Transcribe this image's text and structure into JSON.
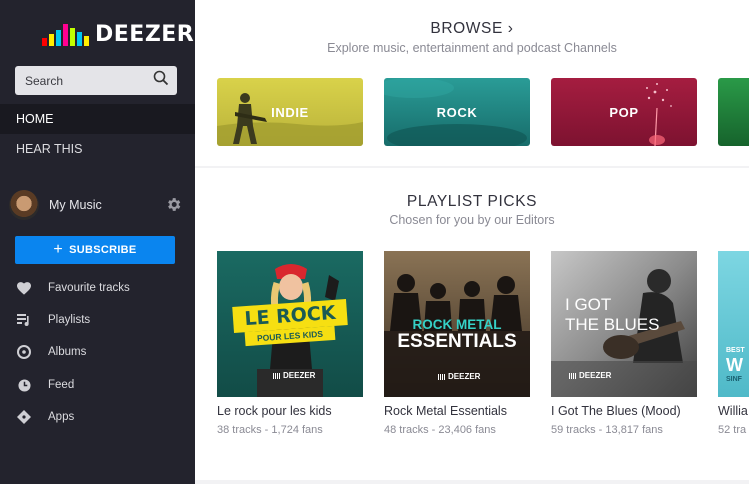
{
  "brand": {
    "logo_text": "DEEZER"
  },
  "search": {
    "placeholder": "Search"
  },
  "nav": [
    {
      "label": "HOME",
      "active": true
    },
    {
      "label": "HEAR THIS",
      "active": false
    }
  ],
  "my_music": {
    "label": "My Music"
  },
  "subscribe": {
    "label": "SUBSCRIBE"
  },
  "library": [
    {
      "label": "Favourite tracks",
      "icon": "heart-icon"
    },
    {
      "label": "Playlists",
      "icon": "playlist-icon"
    },
    {
      "label": "Albums",
      "icon": "album-icon"
    },
    {
      "label": "Feed",
      "icon": "clock-icon"
    },
    {
      "label": "Apps",
      "icon": "apps-icon"
    }
  ],
  "browse": {
    "title": "BROWSE ›",
    "subtitle": "Explore music, entertainment and podcast Channels",
    "channels": [
      {
        "label": "INDIE",
        "color": "#c8c03a"
      },
      {
        "label": "ROCK",
        "color": "#1e8a86"
      },
      {
        "label": "POP",
        "color": "#9a1a3a"
      },
      {
        "label": "",
        "color": "#1f8a3c"
      }
    ]
  },
  "playlist_picks": {
    "title": "PLAYLIST PICKS",
    "subtitle": "Chosen for you by our Editors",
    "covers": [
      {
        "line1": "LE ROCK",
        "line2": "POUR LES KIDS",
        "badge": "DEEZER"
      },
      {
        "line1": "ROCK METAL",
        "line2": "ESSENTIALS",
        "badge": "DEEZER"
      },
      {
        "line1": "I GOT",
        "line2": "THE BLUES",
        "badge": "DEEZER"
      },
      {
        "line1": "BEST",
        "line2": "W",
        "line3": "SINF"
      }
    ],
    "items": [
      {
        "title": "Le rock pour les kids",
        "meta": "38 tracks - 1,724 fans"
      },
      {
        "title": "Rock Metal Essentials",
        "meta": "48 tracks - 23,406 fans"
      },
      {
        "title": "I Got The Blues (Mood)",
        "meta": "59 tracks - 13,817 fans"
      },
      {
        "title": "Willia",
        "meta": "52 tra"
      }
    ]
  }
}
